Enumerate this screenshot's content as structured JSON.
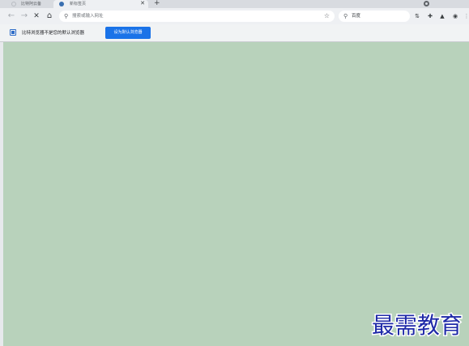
{
  "tabs": [
    {
      "label": "比特阿云备"
    },
    {
      "label": "新标签页"
    }
  ],
  "toolbar": {
    "address_placeholder": "搜索或输入网址",
    "search_engine": "百度"
  },
  "infobar": {
    "message": "比特浏览器不是您的默认浏览器",
    "button_label": "设为默认浏览器"
  },
  "watermark": {
    "text": "最需教育"
  }
}
